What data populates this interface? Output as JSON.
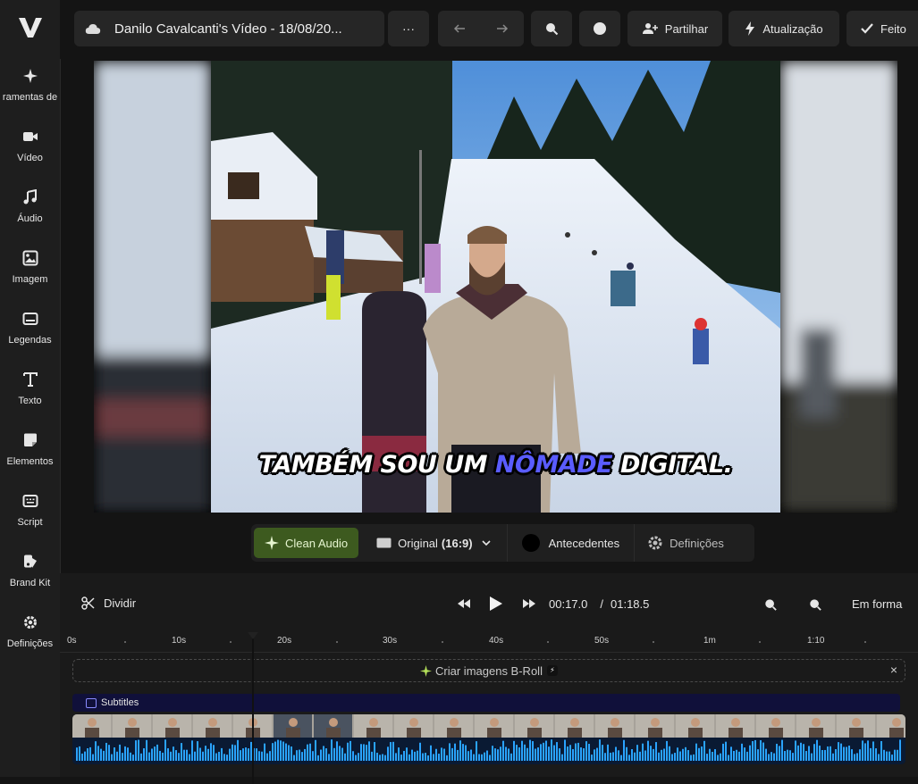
{
  "sidebar": {
    "items": [
      {
        "label": "ramentas de",
        "icon": "sparkle-icon"
      },
      {
        "label": "Vídeo",
        "icon": "video-camera-icon"
      },
      {
        "label": "Áudio",
        "icon": "music-note-icon"
      },
      {
        "label": "Imagem",
        "icon": "image-icon"
      },
      {
        "label": "Legendas",
        "icon": "captions-icon"
      },
      {
        "label": "Texto",
        "icon": "text-icon"
      },
      {
        "label": "Elementos",
        "icon": "elements-icon"
      },
      {
        "label": "Script",
        "icon": "script-icon"
      },
      {
        "label": "Brand Kit",
        "icon": "brand-kit-icon"
      },
      {
        "label": "Definições",
        "icon": "gear-icon"
      }
    ]
  },
  "topbar": {
    "title": "Danilo Cavalcanti's Vídeo - 18/08/20...",
    "more_label": "···",
    "share_label": "Partilhar",
    "update_label": "Atualização",
    "done_label": "Feito"
  },
  "preview": {
    "caption_before": "TAMBÉM SOU UM ",
    "caption_highlight": "NÔMADE",
    "caption_after": " DIGITAL."
  },
  "controls": {
    "clean_audio": "Clean Audio",
    "aspect_original": "Original",
    "aspect_ratio": "(16:9)",
    "background": "Antecedentes",
    "settings": "Definições"
  },
  "timeline": {
    "split_label": "Dividir",
    "current_time": "00:17.0",
    "separator": "/",
    "total_time": "01:18.5",
    "fit_label": "Em forma",
    "ruler_labels": [
      "0s",
      "10s",
      "20s",
      "30s",
      "40s",
      "50s",
      "1m",
      "1:10"
    ],
    "broll_label": "Criar imagens B-Roll",
    "broll_close": "×",
    "subtitles_label": "Subtitles"
  },
  "colors": {
    "accent_green": "#3d5a1f",
    "caption_highlight": "#5a5cff",
    "waveform": "#2aa3ff"
  }
}
